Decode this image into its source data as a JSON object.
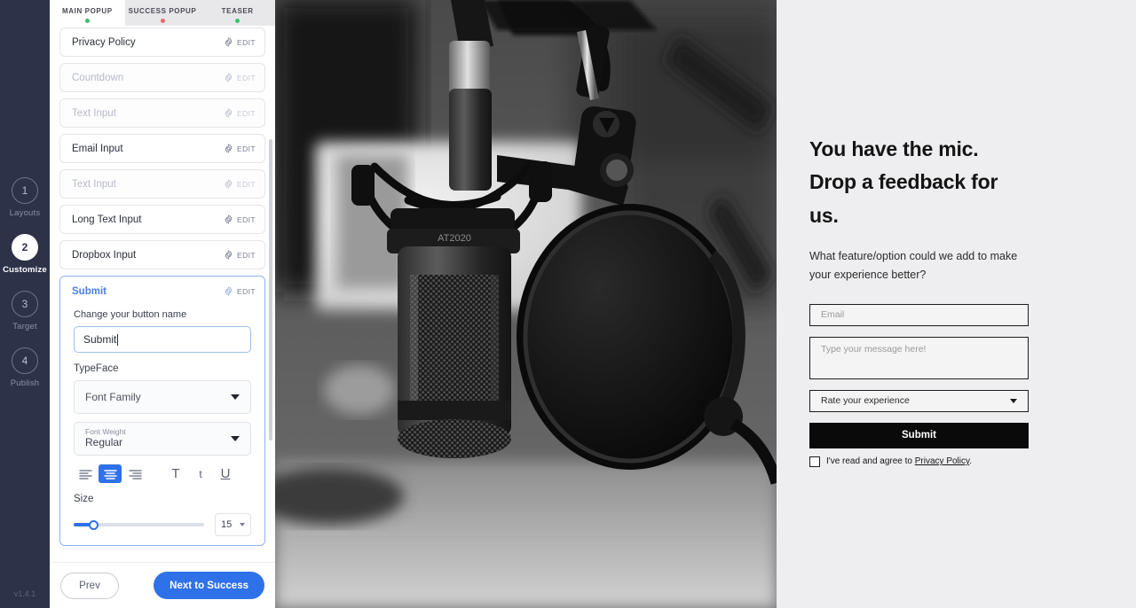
{
  "rail": {
    "steps": [
      {
        "num": "1",
        "label": "Layouts",
        "active": false
      },
      {
        "num": "2",
        "label": "Customize",
        "active": true
      },
      {
        "num": "3",
        "label": "Target",
        "active": false
      },
      {
        "num": "4",
        "label": "Publish",
        "active": false
      }
    ],
    "version": "v1.4.1"
  },
  "tabs": [
    {
      "label": "MAIN POPUP",
      "dot": "#35c46a",
      "active": true
    },
    {
      "label": "SUCCESS POPUP",
      "dot": "#f0656b",
      "active": false
    },
    {
      "label": "TEASER",
      "dot": "#35c46a",
      "active": false
    }
  ],
  "elements": [
    {
      "label": "Privacy Policy",
      "edit": "EDIT",
      "disabled": false
    },
    {
      "label": "Countdown",
      "edit": "EDIT",
      "disabled": true
    },
    {
      "label": "Text Input",
      "edit": "EDIT",
      "disabled": true
    },
    {
      "label": "Email Input",
      "edit": "EDIT",
      "disabled": false
    },
    {
      "label": "Text Input",
      "edit": "EDIT",
      "disabled": true
    },
    {
      "label": "Long Text Input",
      "edit": "EDIT",
      "disabled": false
    },
    {
      "label": "Dropbox Input",
      "edit": "EDIT",
      "disabled": false
    }
  ],
  "submit_card": {
    "title": "Submit",
    "edit": "EDIT",
    "button_name_label": "Change your button name",
    "button_name_value": "Submit",
    "typeface_label": "TypeFace",
    "font_family_value": "Font Family",
    "font_weight_label": "Font Weight",
    "font_weight_value": "Regular",
    "align_options": [
      "align-left",
      "align-center",
      "align-right"
    ],
    "align_active": "align-center",
    "case_options": [
      "uppercase",
      "lowercase",
      "underline"
    ],
    "size_label": "Size",
    "size_value": "15",
    "size_percent": 15
  },
  "footer": {
    "prev_label": "Prev",
    "next_label": "Next to Success"
  },
  "popup_preview": {
    "title": "You have the mic. Drop a feedback for us.",
    "subtitle": "What feature/option could we add to make your experience better?",
    "email_placeholder": "Email",
    "message_placeholder": "Type your message here!",
    "dropdown_value": "Rate your experience",
    "submit_label": "Submit",
    "agree_prefix": "I've read and agree to ",
    "agree_link": "Privacy Policy",
    "agree_suffix": ".",
    "accent_black": "#0a0a0a"
  },
  "theme": {
    "rail_bg": "#2e3249",
    "accent_blue": "#2f71e8",
    "preview_bg": "#eeeef0"
  }
}
